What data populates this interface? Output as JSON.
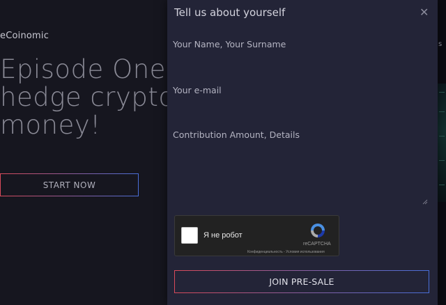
{
  "background": {
    "brand": "eCoinomic",
    "hero_title": "Episode One. L\nhedge crypto -\nmoney!",
    "start_button": "START NOW"
  },
  "modal": {
    "title": "Tell us about yourself",
    "close_icon": "close-icon",
    "name_placeholder": "Your Name, Your Surname",
    "email_placeholder": "Your e-mail",
    "details_placeholder": "Contribution Amount, Details",
    "captcha": {
      "label": "Я не робот",
      "brand": "reCAPTCHA",
      "terms": "Конфиденциальность - Условия использования"
    },
    "join_button": "JOIN PRE-SALE"
  },
  "right_edge": {
    "letter": "s"
  },
  "colors": {
    "accent_red": "#d94a5a",
    "accent_blue": "#4a6fd9",
    "modal_bg": "#232437"
  }
}
